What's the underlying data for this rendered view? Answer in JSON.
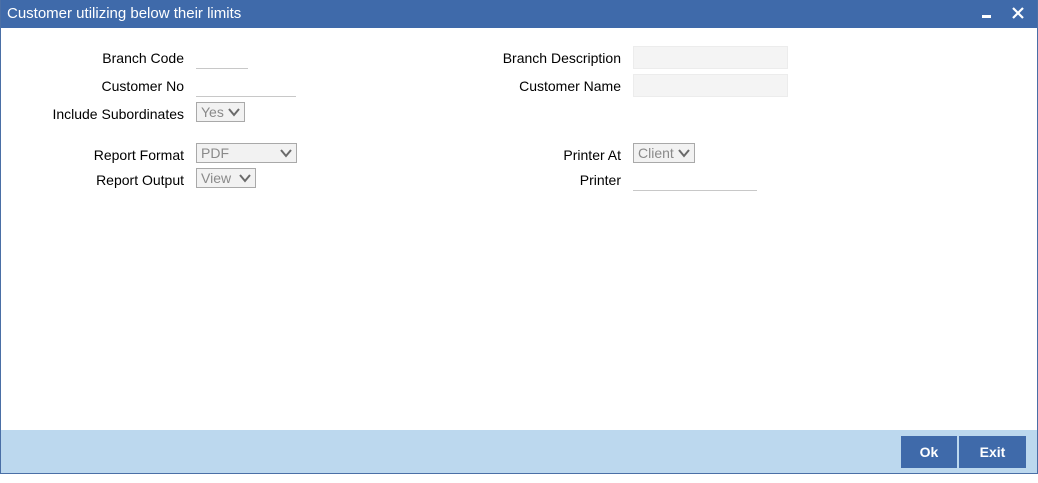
{
  "window": {
    "title": "Customer utilizing below their limits"
  },
  "form": {
    "branch_code": {
      "label": "Branch Code",
      "value": ""
    },
    "branch_description": {
      "label": "Branch Description",
      "value": ""
    },
    "customer_no": {
      "label": "Customer No",
      "value": ""
    },
    "customer_name": {
      "label": "Customer Name",
      "value": ""
    },
    "include_subordinates": {
      "label": "Include Subordinates",
      "value": "Yes"
    },
    "report_format": {
      "label": "Report Format",
      "value": "PDF"
    },
    "printer_at": {
      "label": "Printer At",
      "value": "Client"
    },
    "report_output": {
      "label": "Report Output",
      "value": "View"
    },
    "printer": {
      "label": "Printer",
      "value": ""
    }
  },
  "footer": {
    "ok_label": "Ok",
    "exit_label": "Exit"
  },
  "icons": {
    "minimize": "minimize-icon",
    "close": "close-icon",
    "dropdown": "chevron-down-icon"
  },
  "colors": {
    "titlebar": "#3f6aaa",
    "footer": "#bcd8ee",
    "button": "#3f6aaa"
  }
}
